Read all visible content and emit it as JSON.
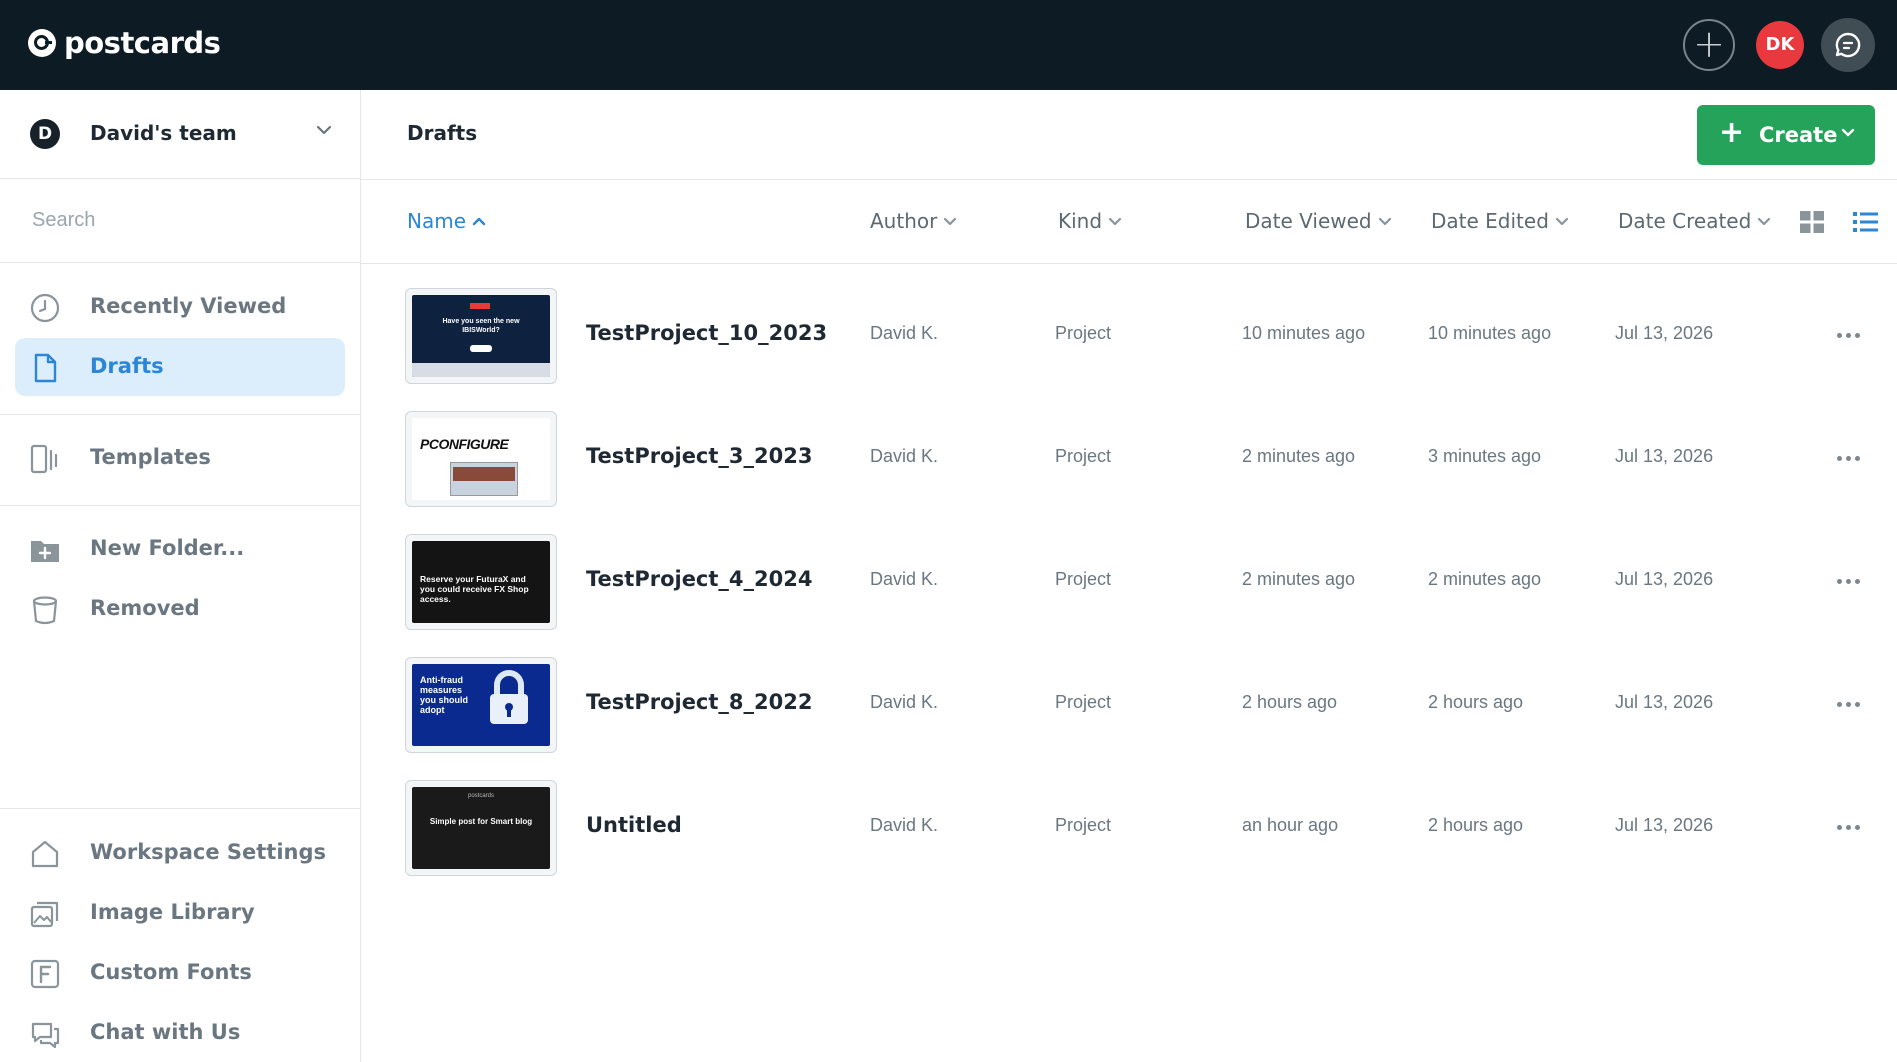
{
  "app": {
    "logo": "postcards",
    "user_initials": "DK"
  },
  "sidebar": {
    "team_initial": "D",
    "team_name": "David's team",
    "search_placeholder": "Search",
    "nav": [
      {
        "label": "Recently Viewed",
        "icon": "clock-icon"
      },
      {
        "label": "Drafts",
        "icon": "document-icon",
        "active": true
      },
      {
        "label": "Templates",
        "icon": "templates-icon"
      },
      {
        "label": "New Folder...",
        "icon": "new-folder-icon"
      },
      {
        "label": "Removed",
        "icon": "trash-icon"
      }
    ],
    "bottom": [
      {
        "label": "Workspace Settings",
        "icon": "home-icon"
      },
      {
        "label": "Image Library",
        "icon": "image-library-icon"
      },
      {
        "label": "Custom Fonts",
        "icon": "font-icon"
      },
      {
        "label": "Chat with Us",
        "icon": "chat-icon"
      }
    ]
  },
  "header": {
    "title": "Drafts",
    "create_label": "Create"
  },
  "columns": {
    "name": "Name",
    "author": "Author",
    "kind": "Kind",
    "date_viewed": "Date Viewed",
    "date_edited": "Date Edited",
    "date_created": "Date Created"
  },
  "rows": [
    {
      "name": "TestProject_10_2023",
      "author": "David K.",
      "kind": "Project",
      "viewed": "10 minutes ago",
      "edited": "10 minutes ago",
      "created": "Jul 13, 2026",
      "thumb_text": "Have you seen the new IBISWorld?",
      "thumb_bg": "#0e2240"
    },
    {
      "name": "TestProject_3_2023",
      "author": "David K.",
      "kind": "Project",
      "viewed": "2 minutes ago",
      "edited": "3 minutes ago",
      "created": "Jul 13, 2026",
      "thumb_text": "PCONFIGURE",
      "thumb_bg": "#ffffff"
    },
    {
      "name": "TestProject_4_2024",
      "author": "David K.",
      "kind": "Project",
      "viewed": "2 minutes ago",
      "edited": "2 minutes ago",
      "created": "Jul 13, 2026",
      "thumb_text": "Reserve your FuturaX and you could receive FX Shop access.",
      "thumb_bg": "#141414"
    },
    {
      "name": "TestProject_8_2022",
      "author": "David K.",
      "kind": "Project",
      "viewed": "2 hours ago",
      "edited": "2 hours ago",
      "created": "Jul 13, 2026",
      "thumb_text": "Anti-fraud measures you should adopt",
      "thumb_bg": "#0b2a8f"
    },
    {
      "name": "Untitled",
      "author": "David K.",
      "kind": "Project",
      "viewed": "an hour ago",
      "edited": "2 hours ago",
      "created": "Jul 13, 2026",
      "thumb_text": "Simple post for Smart blog",
      "thumb_bg": "#1a1a1a",
      "thumb_brand": "postcards"
    }
  ],
  "colors": {
    "topbar": "#0d1b24",
    "accent_blue": "#2b86d6",
    "create_green": "#25a35a",
    "avatar_red": "#e8393e"
  }
}
